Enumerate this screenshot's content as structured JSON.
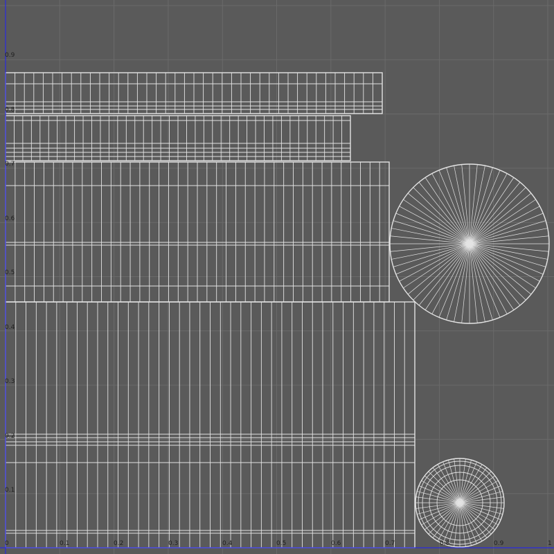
{
  "colors": {
    "background": "#5a5a5a",
    "grid": "#6a6a6a",
    "uv_boundary": "#2a2ae0",
    "wireframe": "#e4e4e4"
  },
  "axis": {
    "u_ticks": [
      "0",
      "0.1",
      "0.2",
      "0.3",
      "0.4",
      "0.5",
      "0.6",
      "0.7",
      "0.8",
      "0.9",
      "1"
    ],
    "v_ticks": [
      "0.1",
      "0.2",
      "0.3",
      "0.4",
      "0.5",
      "0.6",
      "0.7",
      "0.8",
      "0.9"
    ]
  }
}
